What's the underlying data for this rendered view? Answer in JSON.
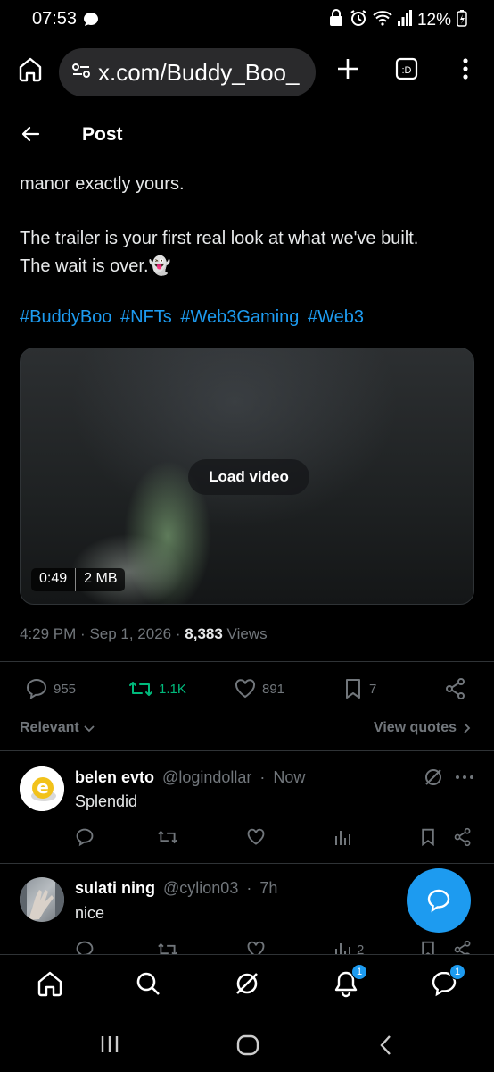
{
  "status_bar": {
    "time": "07:53",
    "battery": "12%"
  },
  "browser": {
    "url": "x.com/Buddy_Boo_"
  },
  "header": {
    "title": "Post"
  },
  "post": {
    "line1": "manor exactly yours.",
    "line2": "The trailer is your first real look at what we've built.",
    "line3": "The wait is over.",
    "emoji": "👻",
    "hashtags": [
      "#BuddyBoo",
      "#NFTs",
      "#Web3Gaming",
      "#Web3"
    ],
    "video": {
      "load_label": "Load video",
      "duration": "0:49",
      "size": "2 MB"
    },
    "time": "4:29 PM",
    "date": "Sep 1, 2026",
    "views_count": "8,383",
    "views_label": "Views"
  },
  "actions": {
    "replies": "955",
    "reposts": "1.1K",
    "likes": "891",
    "bookmarks": "7"
  },
  "sort": {
    "relevant": "Relevant",
    "view_quotes": "View quotes"
  },
  "replies": [
    {
      "name": "belen evto",
      "handle": "@logindollar",
      "sep": "·",
      "time": "Now",
      "text": "Splendid",
      "avatar_letter": "e",
      "views": ""
    },
    {
      "name": "sulati ning",
      "handle": "@cylion03",
      "sep": "·",
      "time": "7h",
      "text": "nice",
      "views": "2"
    }
  ],
  "nav": {
    "notifications_badge": "1",
    "messages_badge": "1"
  },
  "colors": {
    "accent": "#1d9bf0",
    "repost_active": "#00ba7c",
    "muted": "#71767b"
  }
}
